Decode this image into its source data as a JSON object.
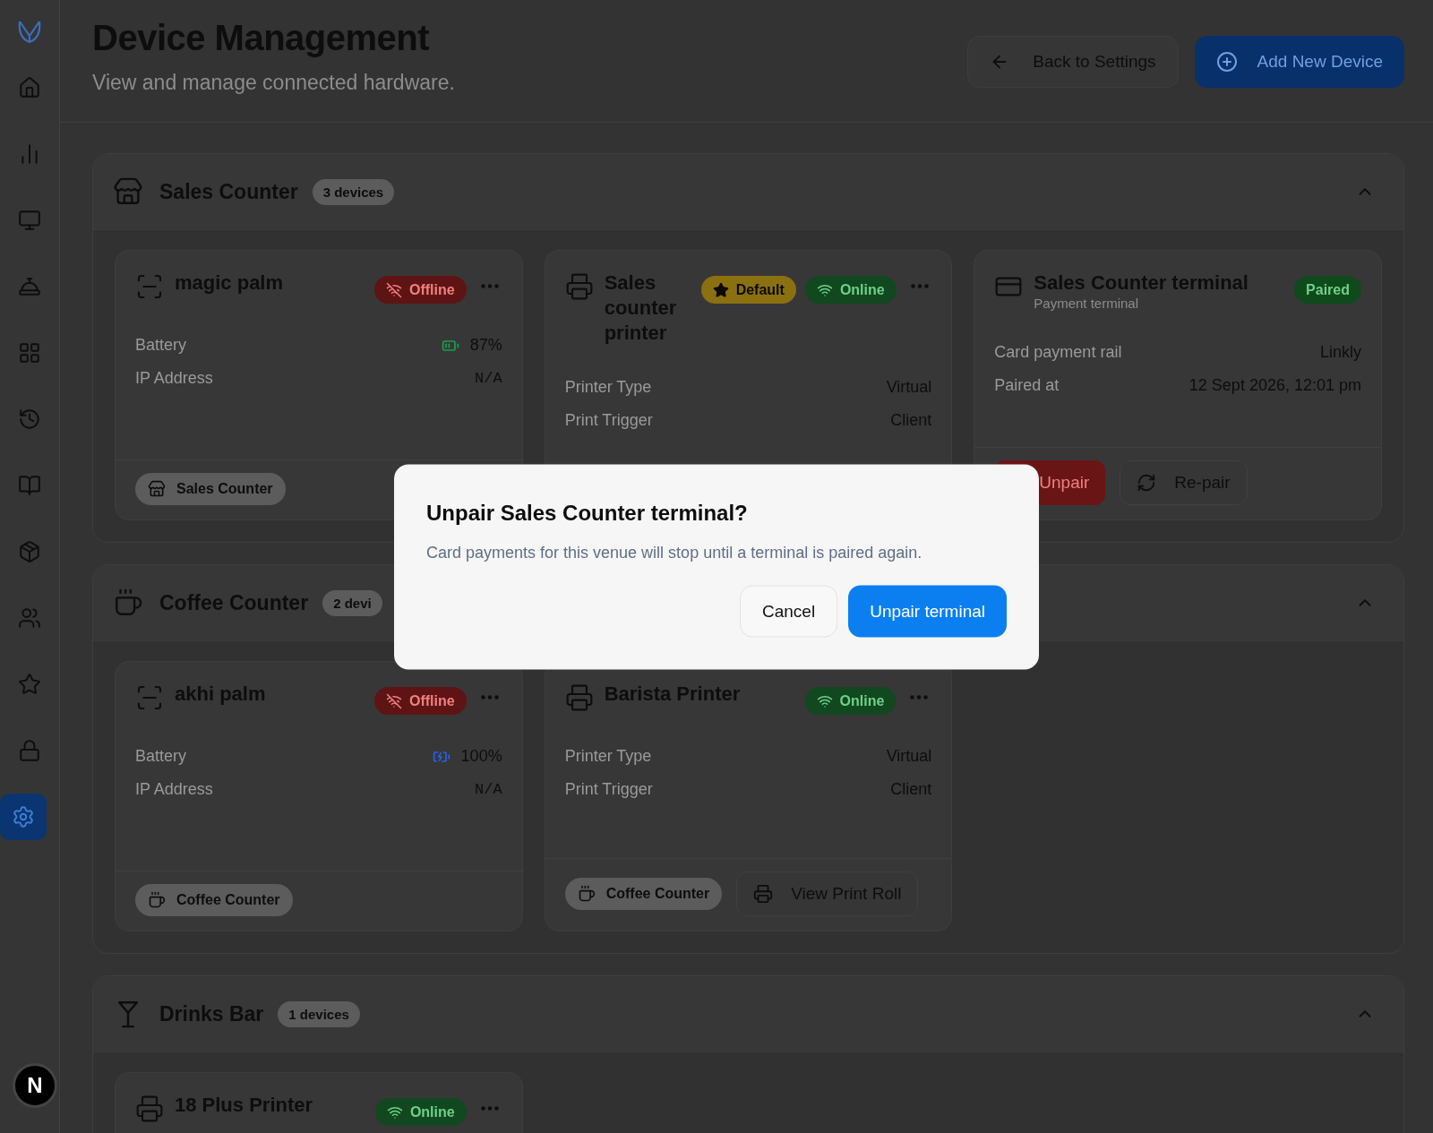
{
  "sidebar": {
    "items": [
      {
        "selected": false
      },
      {
        "selected": false
      },
      {
        "selected": false
      },
      {
        "selected": false
      },
      {
        "selected": false
      },
      {
        "selected": false
      },
      {
        "selected": false
      },
      {
        "selected": false
      },
      {
        "selected": false
      },
      {
        "selected": false
      },
      {
        "selected": false
      },
      {
        "selected": true
      }
    ],
    "dev_indicator": "N"
  },
  "header": {
    "title": "Device Management",
    "subtitle": "View and manage connected hardware.",
    "back_button": "Back to Settings",
    "add_button": "Add New Device"
  },
  "sections": [
    {
      "name": "Sales Counter",
      "count": "3 devices",
      "expanded": true,
      "devices": [
        {
          "kind": "palm",
          "name": "magic palm",
          "badges": [
            {
              "kind": "offline",
              "label": "Offline"
            }
          ],
          "rows": [
            {
              "kind": "battery",
              "label": "Battery",
              "value": "87%",
              "charging": false
            },
            {
              "kind": "mono",
              "label": "IP Address",
              "value": "N/A"
            }
          ],
          "footer": {
            "location": "Sales Counter"
          }
        },
        {
          "kind": "printer",
          "name": "Sales counter printer",
          "badges": [
            {
              "kind": "default",
              "label": "Default"
            },
            {
              "kind": "online",
              "label": "Online"
            }
          ],
          "rows": [
            {
              "kind": "text",
              "label": "Printer Type",
              "value": "Virtual"
            },
            {
              "kind": "text",
              "label": "Print Trigger",
              "value": "Client"
            }
          ]
        },
        {
          "kind": "terminal",
          "name": "Sales Counter terminal",
          "subtitle": "Payment terminal",
          "badges": [
            {
              "kind": "paired",
              "label": "Paired"
            }
          ],
          "rows": [
            {
              "kind": "text",
              "label": "Card payment rail",
              "value": "Linkly"
            },
            {
              "kind": "text",
              "label": "Paired at",
              "value": "12 Sept 2026, 12:01 pm"
            }
          ],
          "footer": {
            "actions": [
              {
                "kind": "unpair",
                "label": "Unpair"
              },
              {
                "kind": "repair",
                "label": "Re-pair"
              }
            ]
          }
        }
      ]
    },
    {
      "name": "Coffee Counter",
      "count": "2 devi",
      "expanded": true,
      "devices": [
        {
          "kind": "palm",
          "name": "akhi palm",
          "badges": [
            {
              "kind": "offline",
              "label": "Offline"
            }
          ],
          "rows": [
            {
              "kind": "battery",
              "label": "Battery",
              "value": "100%",
              "charging": true
            },
            {
              "kind": "mono",
              "label": "IP Address",
              "value": "N/A"
            }
          ],
          "footer": {
            "location": "Coffee Counter"
          }
        },
        {
          "kind": "printer",
          "name": "Barista Printer",
          "badges": [
            {
              "kind": "online",
              "label": "Online"
            }
          ],
          "rows": [
            {
              "kind": "text",
              "label": "Printer Type",
              "value": "Virtual"
            },
            {
              "kind": "text",
              "label": "Print Trigger",
              "value": "Client"
            }
          ],
          "footer": {
            "location": "Coffee Counter",
            "actions": [
              {
                "kind": "print_roll",
                "label": "View Print Roll"
              }
            ]
          }
        }
      ]
    },
    {
      "name": "Drinks Bar",
      "count": "1 devices",
      "expanded": true,
      "devices": [
        {
          "kind": "printer",
          "name": "18 Plus Printer",
          "badges": [
            {
              "kind": "online",
              "label": "Online"
            }
          ]
        }
      ]
    }
  ],
  "dialog": {
    "title": "Unpair Sales Counter terminal?",
    "message": "Card payments for this venue will stop until a terminal is paired again.",
    "cancel": "Cancel",
    "confirm": "Unpair terminal"
  }
}
